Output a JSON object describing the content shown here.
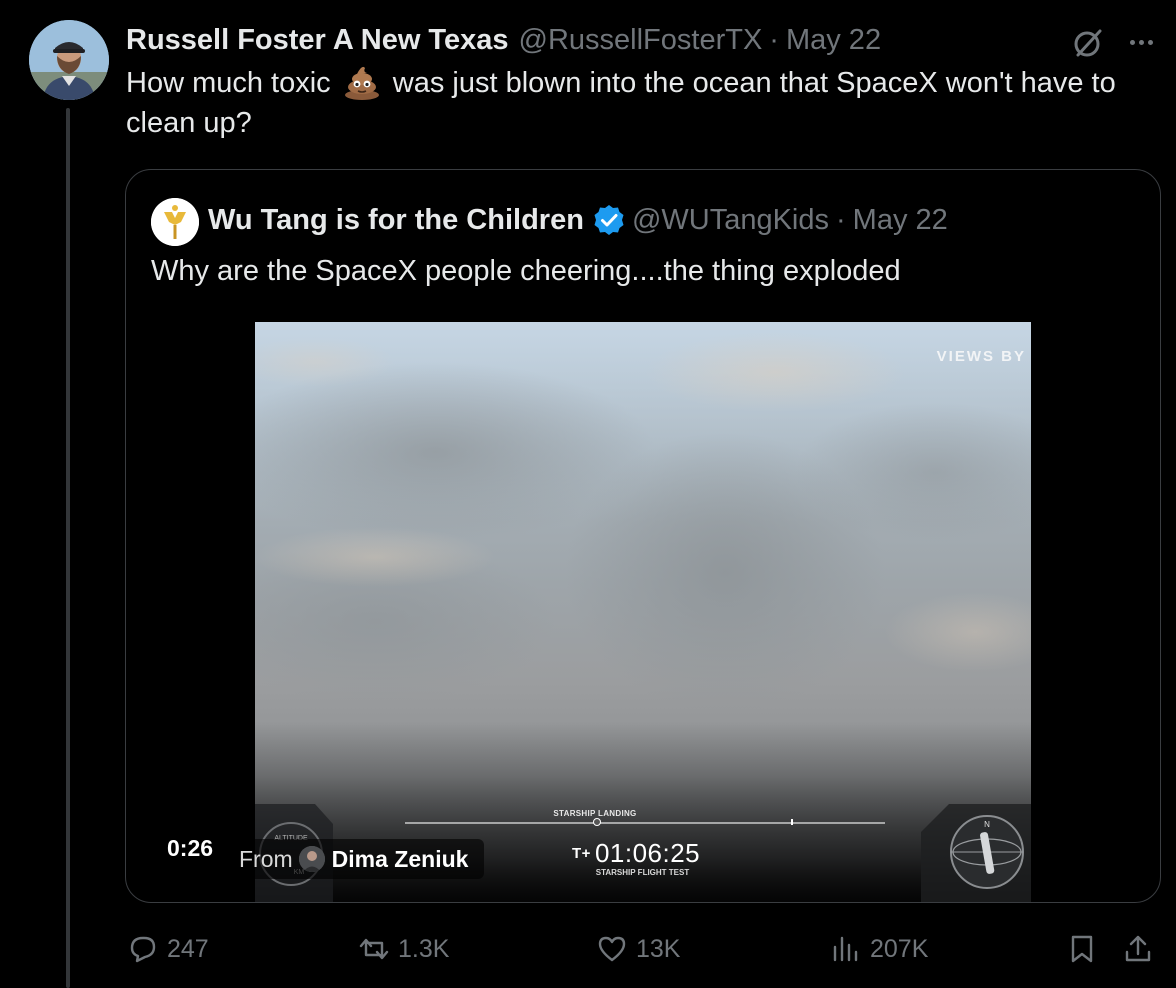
{
  "tweet": {
    "author_name": "Russell Foster A New Texas",
    "handle": "@RussellFosterTX",
    "separator": "·",
    "date": "May 22",
    "text_before_emoji": "How much toxic",
    "emoji": "pile-of-poo-emoji",
    "text_after_emoji": "was just blown into the ocean that SpaceX won't have to clean up?"
  },
  "quote": {
    "author_name": "Wu Tang is for the Children",
    "verified": true,
    "handle": "@WUTangKids",
    "separator": "·",
    "date": "May 22",
    "text": "Why are the SpaceX people cheering....the thing exploded",
    "video": {
      "watermark": "VIEWS BY",
      "progress_label": "STARSHIP LANDING",
      "progress_fraction": 0.4,
      "altitude_label": "ALTITUDE",
      "altitude_unit": "KM",
      "compass_label": "N",
      "clock_prefix": "T+",
      "clock": "01:06:25",
      "subtitle": "STARSHIP FLIGHT TEST",
      "duration": "0:26",
      "from_label": "From",
      "from_name": "Dima Zeniuk"
    }
  },
  "actions": {
    "replies": "247",
    "reposts": "1.3K",
    "likes": "13K",
    "views": "207K"
  },
  "colors": {
    "background": "#000000",
    "text_primary": "#e7e9ea",
    "text_secondary": "#71767b",
    "border": "#3a3d41",
    "verified_blue": "#1d9bf0"
  },
  "icons": [
    "grok-icon",
    "more-icon",
    "verified-icon",
    "reply-icon",
    "repost-icon",
    "like-icon",
    "views-icon",
    "bookmark-icon",
    "share-icon"
  ]
}
